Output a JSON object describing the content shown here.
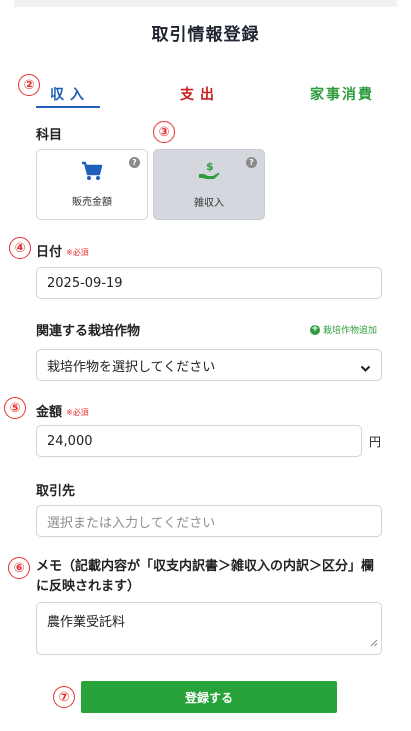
{
  "page": {
    "title": "取引情報登録"
  },
  "markers": {
    "m2": "②",
    "m3": "③",
    "m4": "④",
    "m5": "⑤",
    "m6": "⑥",
    "m7": "⑦"
  },
  "tabs": [
    {
      "label": "収入",
      "active": true,
      "color": "#1f5fb8"
    },
    {
      "label": "支出",
      "active": false,
      "color": "#c81e1e"
    },
    {
      "label": "家事消費",
      "active": false,
      "color": "#2e9c3e"
    }
  ],
  "category": {
    "label": "科目",
    "options": [
      {
        "label": "販売金額",
        "icon": "cart-icon",
        "selected": false,
        "help": "?"
      },
      {
        "label": "雑収入",
        "icon": "hand-coin-icon",
        "selected": true,
        "help": "?"
      }
    ]
  },
  "date": {
    "label": "日付",
    "required": "※必須",
    "value": "2025-09-19"
  },
  "crop": {
    "label": "関連する栽培作物",
    "add_label": "栽培作物追加",
    "add_symbol": "+",
    "selected": "栽培作物を選択してください"
  },
  "amount": {
    "label": "金額",
    "required": "※必須",
    "value": "24,000",
    "unit": "円"
  },
  "partner": {
    "label": "取引先",
    "placeholder": "選択または入力してください"
  },
  "memo": {
    "label": "メモ（記載内容が「収支内訳書＞雑収入の内訳＞区分」欄に反映されます）",
    "value": "農作業受託料"
  },
  "submit": {
    "label": "登録する"
  },
  "colors": {
    "primary": "#1f5fb8",
    "danger": "#c81e1e",
    "success": "#27a33a",
    "marker": "#e53030"
  }
}
